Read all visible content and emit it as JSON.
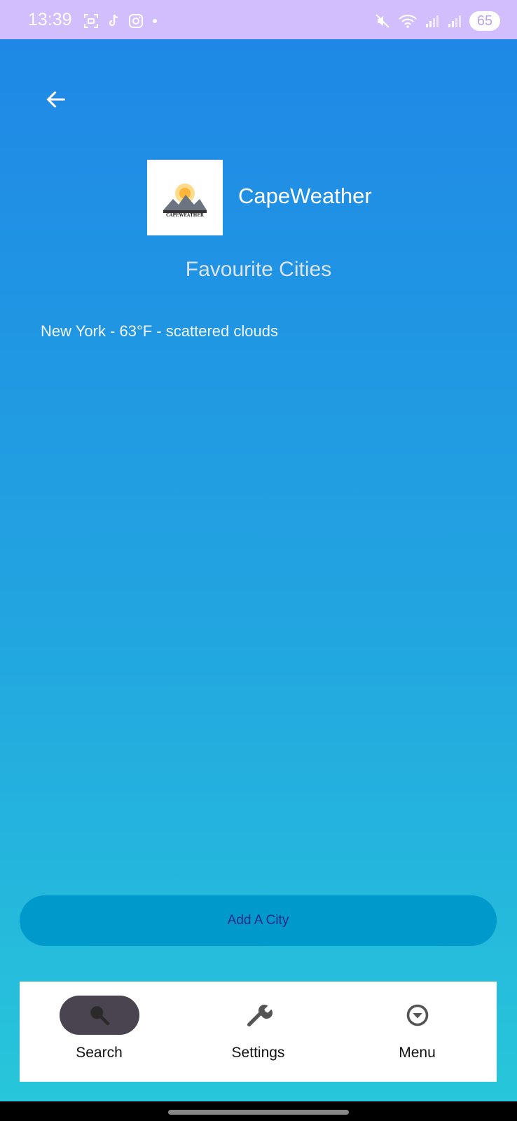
{
  "status_bar": {
    "time": "13:39",
    "battery": "65",
    "bg_color": "#d2bdfd"
  },
  "header": {
    "back_icon": "arrow-left-icon",
    "app_name": "CapeWeather",
    "logo_text": "CAPEWEATHER"
  },
  "main": {
    "heading": "Favourite Cities",
    "cities": [
      {
        "label": "New York - 63°F - scattered clouds"
      }
    ],
    "add_button_label": "Add A City"
  },
  "bottom_nav": {
    "items": [
      {
        "label": "Search",
        "icon": "search-icon",
        "active": true
      },
      {
        "label": "Settings",
        "icon": "wrench-icon",
        "active": false
      },
      {
        "label": "Menu",
        "icon": "chevron-circle-down-icon",
        "active": false
      }
    ]
  },
  "colors": {
    "gradient_top": "#1f88e6",
    "gradient_bottom": "#27c6da",
    "button_bg": "#0099cc",
    "button_text": "#1e2a8a",
    "nav_active_bg": "#49444f"
  }
}
